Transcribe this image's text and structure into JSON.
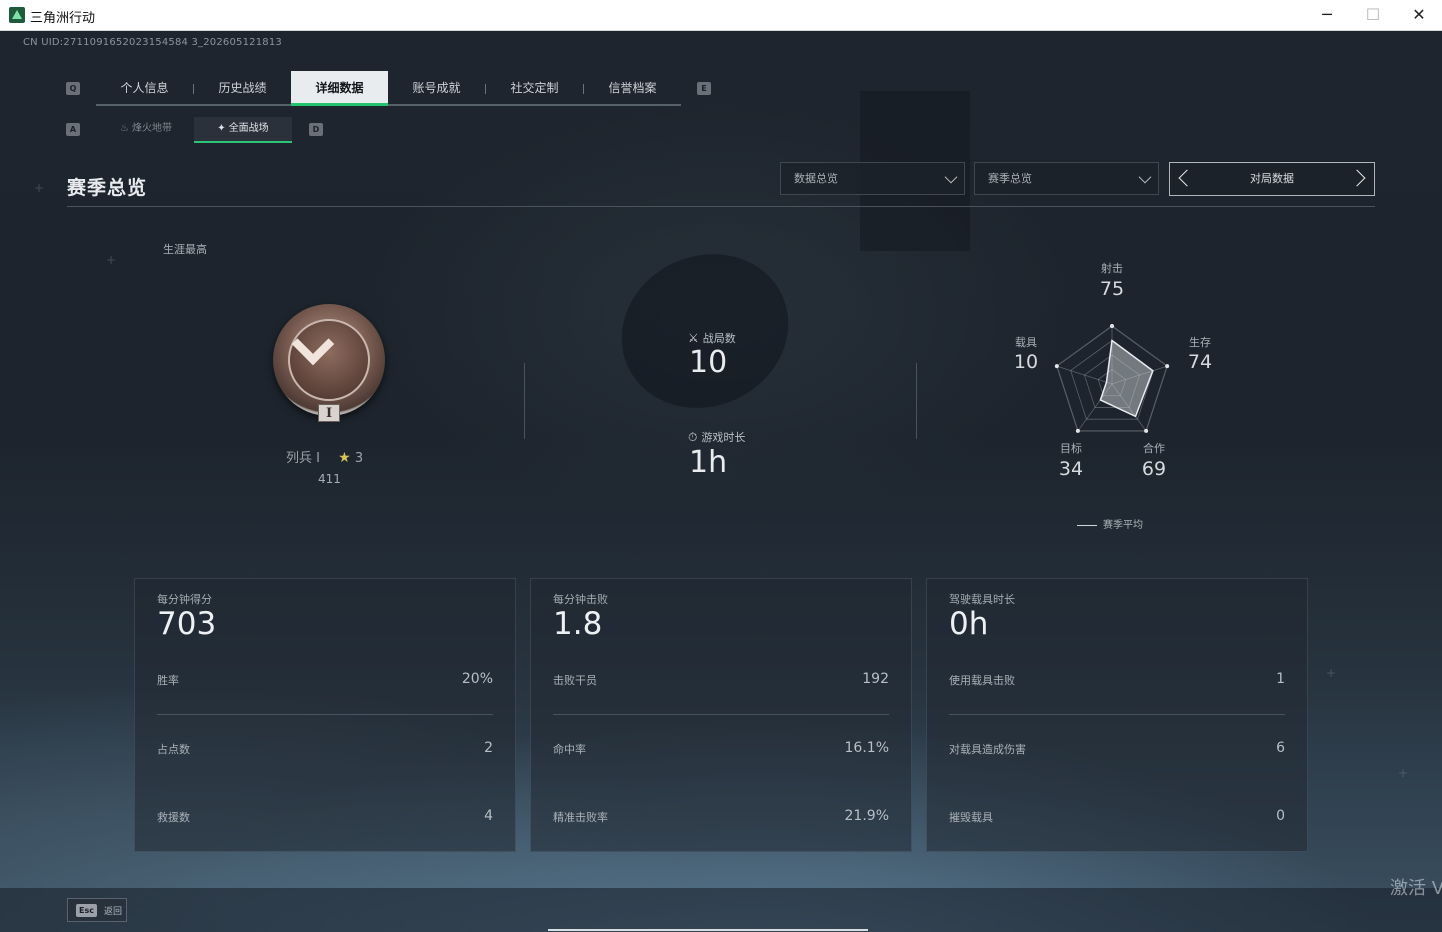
{
  "window": {
    "title": "三角洲行动",
    "controls": {
      "minimize": "─",
      "maximize": "☐",
      "close": "✕"
    }
  },
  "uid_text": "CN UID:2711091652023154584 3_202605121813",
  "key_hints": {
    "prev_tab": "Q",
    "next_tab": "E",
    "prev_sub": "A",
    "next_sub": "D"
  },
  "main_tabs": [
    {
      "label": "个人信息",
      "active": false
    },
    {
      "label": "历史战绩",
      "active": false
    },
    {
      "label": "详细数据",
      "active": true
    },
    {
      "label": "账号成就",
      "active": false
    },
    {
      "label": "社交定制",
      "active": false
    },
    {
      "label": "信誉档案",
      "active": false
    }
  ],
  "sub_tabs": [
    {
      "label": "烽火地带",
      "icon": "flame-zone-icon",
      "glyph": "♨",
      "active": false
    },
    {
      "label": "全面战场",
      "icon": "battlefield-icon",
      "glyph": "✦",
      "active": true
    }
  ],
  "section": {
    "title": "赛季总览"
  },
  "filters": {
    "data_overview": "数据总览",
    "season_overview": "赛季总览",
    "match_data": "对局数据"
  },
  "rank": {
    "career_label": "生涯最高",
    "medal_numeral": "I",
    "name": "列兵 I",
    "stars": "3",
    "points": "411"
  },
  "summary": {
    "matches_label": "战局数",
    "matches_value": "10",
    "playtime_label": "游戏时长",
    "playtime_value": "1h"
  },
  "radar": {
    "max": 100,
    "axes": [
      {
        "label": "射击",
        "value": 75
      },
      {
        "label": "生存",
        "value": 74
      },
      {
        "label": "合作",
        "value": 69
      },
      {
        "label": "目标",
        "value": 34
      },
      {
        "label": "载具",
        "value": 10
      }
    ],
    "legend": "赛季平均"
  },
  "cards": [
    {
      "title": "每分钟得分",
      "value": "703",
      "rows": [
        {
          "label": "胜率",
          "value": "20%"
        },
        {
          "label": "占点数",
          "value": "2"
        },
        {
          "label": "救援数",
          "value": "4"
        }
      ]
    },
    {
      "title": "每分钟击败",
      "value": "1.8",
      "rows": [
        {
          "label": "击败干员",
          "value": "192"
        },
        {
          "label": "命中率",
          "value": "16.1%"
        },
        {
          "label": "精准击败率",
          "value": "21.9%"
        }
      ]
    },
    {
      "title": "驾驶载具时长",
      "value": "0h",
      "rows": [
        {
          "label": "使用载具击败",
          "value": "1"
        },
        {
          "label": "对载具造成伤害",
          "value": "6"
        },
        {
          "label": "摧毁载具",
          "value": "0"
        }
      ]
    }
  ],
  "footer": {
    "esc_key": "Esc",
    "esc_label": "返回",
    "activate_text": "激活 V"
  },
  "colors": {
    "accent_green": "#23c46e",
    "panel_bg": "#1e252e"
  }
}
